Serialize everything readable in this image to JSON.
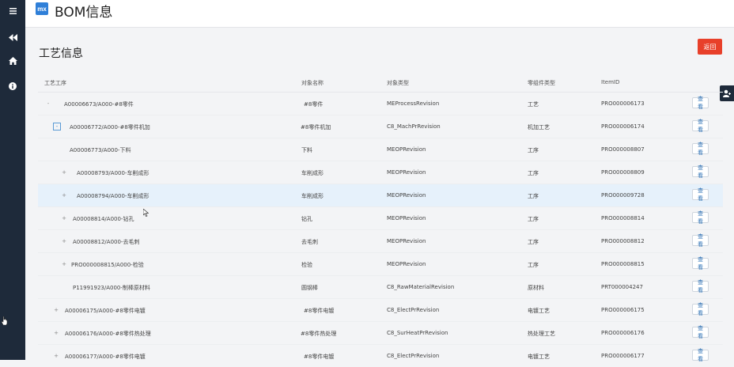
{
  "header": {
    "logo_text": "mx",
    "title": "BOM信息"
  },
  "page": {
    "title": "工艺信息",
    "back_label": "返回"
  },
  "table": {
    "columns": [
      "工艺工序",
      "对象名称",
      "对象类型",
      "零组件类型",
      "ItemID"
    ],
    "action_label": "查看",
    "rows": [
      {
        "toggle": "-",
        "name": "A00006673/A000-#8零件",
        "object_name": "#8零件",
        "object_type": "MEProcessRevision",
        "part_type": "工艺",
        "item_id": "PRO000006173"
      },
      {
        "toggle": "-",
        "name": "A00006772/A000-#8零件机加",
        "object_name": "#8零件机加",
        "object_type": "C8_MachPrRevision",
        "part_type": "机加工艺",
        "item_id": "PRO000006174"
      },
      {
        "toggle": "",
        "name": "A00006773/A000-下料",
        "object_name": "下料",
        "object_type": "MEOPRevision",
        "part_type": "工序",
        "item_id": "PRO000008807"
      },
      {
        "toggle": "+",
        "name": "A00008793/A000-车削成形",
        "object_name": "车削成形",
        "object_type": "MEOPRevision",
        "part_type": "工序",
        "item_id": "PRO000008809"
      },
      {
        "toggle": "+",
        "name": "A00008794/A000-车削成形",
        "object_name": "车削成形",
        "object_type": "MEOPRevision",
        "part_type": "工序",
        "item_id": "PRO000009728"
      },
      {
        "toggle": "+",
        "name": "A00008814/A000-钻孔",
        "object_name": "钻孔",
        "object_type": "MEOPRevision",
        "part_type": "工序",
        "item_id": "PRO000008814"
      },
      {
        "toggle": "+",
        "name": "A00008812/A000-去毛刺",
        "object_name": "去毛刺",
        "object_type": "MEOPRevision",
        "part_type": "工序",
        "item_id": "PRO000008812"
      },
      {
        "toggle": "+",
        "name": "PRO000008815/A000-检验",
        "object_name": "检验",
        "object_type": "MEOPRevision",
        "part_type": "工序",
        "item_id": "PRO000008815"
      },
      {
        "toggle": "",
        "name": "P11991923/A000-制棒原材料",
        "object_name": "圆钢棒",
        "object_type": "C8_RawMaterialRevision",
        "part_type": "原材料",
        "item_id": "PRT000004247"
      },
      {
        "toggle": "+",
        "name": "A00006175/A000-#8零件电镀",
        "object_name": "#8零件电镀",
        "object_type": "C8_ElectPrRevision",
        "part_type": "电镀工艺",
        "item_id": "PRO000006175"
      },
      {
        "toggle": "+",
        "name": "A00006176/A000-#8零件热处理",
        "object_name": "#8零件热处理",
        "object_type": "C8_SurHeatPrRevision",
        "part_type": "热处理工艺",
        "item_id": "PRO000006176"
      },
      {
        "toggle": "+",
        "name": "A00006177/A000-#8零件电镀",
        "object_name": "#8零件电镀",
        "object_type": "C8_ElectPrRevision",
        "part_type": "电镀工艺",
        "item_id": "PRO000006177"
      }
    ]
  }
}
